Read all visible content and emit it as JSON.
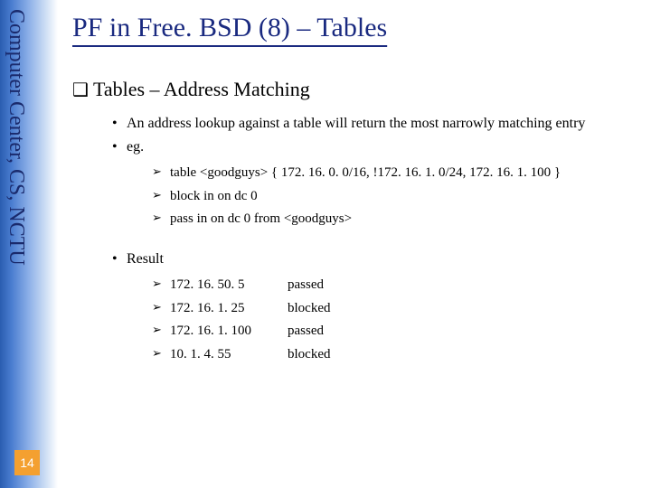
{
  "sidebar": {
    "org": "Computer Center, CS, NCTU",
    "page_number": "14"
  },
  "title": "PF in Free. BSD (8) – Tables",
  "section_heading": "Tables – Address Matching",
  "bullets": {
    "b1": "An address lookup against a table will return the most narrowly matching entry",
    "b2": "eg.",
    "b3": "Result"
  },
  "example": {
    "line1": "table <goodguys> { 172. 16. 0. 0/16, !172. 16. 1. 0/24, 172. 16. 1. 100 }",
    "line2": "block in on dc 0",
    "line3": "pass  in on dc 0 from <goodguys>"
  },
  "results": [
    {
      "ip": "172. 16. 50. 5",
      "status": "passed"
    },
    {
      "ip": "172. 16. 1. 25",
      "status": "blocked"
    },
    {
      "ip": "172. 16. 1. 100",
      "status": "passed"
    },
    {
      "ip": "10. 1. 4. 55",
      "status": "blocked"
    }
  ]
}
